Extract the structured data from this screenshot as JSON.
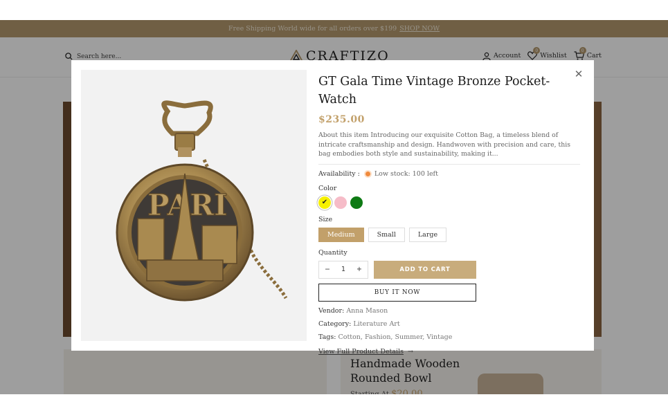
{
  "announcement": {
    "text": "Free Shipping World wide for all orders over $199",
    "link": "SHOP NOW"
  },
  "header": {
    "search_placeholder": "Search here...",
    "logo": "CRAFTIZO",
    "account": "Account",
    "wishlist": "Wishlist",
    "wishlist_count": "0",
    "cart": "Cart",
    "cart_count": "0"
  },
  "background": {
    "card_title": "Handmade Wooden Rounded Bowl",
    "card_price_prefix": "Starting At",
    "card_price": "$20.00"
  },
  "modal": {
    "title": "GT Gala Time Vintage Bronze Pocket-Watch",
    "price": "$235.00",
    "description": "About this item Introducing our exquisite Cotton Bag, a timeless blend of intricate craftsmanship and design. Handwoven with precision and care, this bag embodies both style and sustainability, making it...",
    "availability_label": "Availability :",
    "availability_value": "Low stock: 100 left",
    "color_label": "Color",
    "colors": [
      {
        "name": "yellow",
        "hex": "#f6f000",
        "selected": true
      },
      {
        "name": "pink",
        "hex": "#f6bcc8",
        "selected": false
      },
      {
        "name": "green",
        "hex": "#0e7a14",
        "selected": false
      }
    ],
    "size_label": "Size",
    "sizes": [
      "Medium",
      "Small",
      "Large"
    ],
    "selected_size": "Medium",
    "quantity_label": "Quantity",
    "quantity": "1",
    "add_to_cart": "ADD TO CART",
    "buy_now": "BUY IT NOW",
    "vendor_label": "Vendor:",
    "vendor": "Anna Mason",
    "category_label": "Category:",
    "category": "Literature Art",
    "tags_label": "Tags:",
    "tags": "Cotton, Fashion, Summer, Vintage",
    "full_details": "View Full Product Details"
  }
}
